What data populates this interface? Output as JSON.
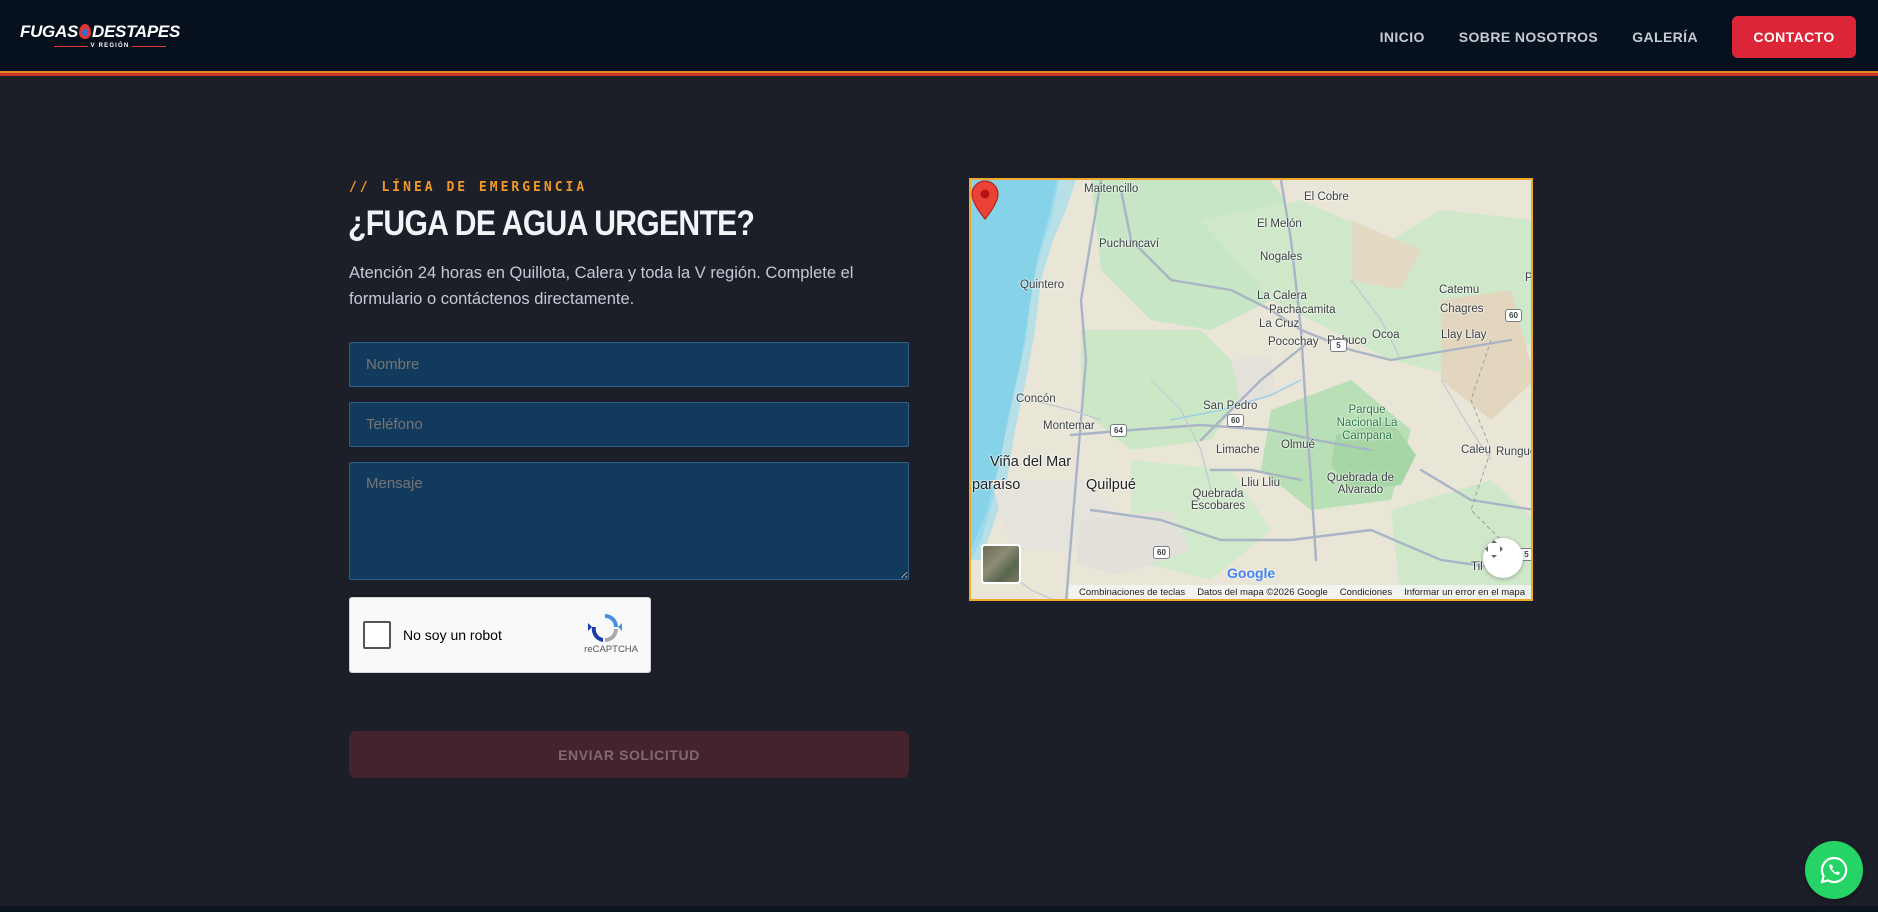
{
  "header": {
    "logo_text_left": "FUGAS",
    "logo_text_right": "DESTAPES",
    "logo_subtitle": "V REGIÓN",
    "nav": [
      {
        "label": "INICIO"
      },
      {
        "label": "SOBRE NOSOTROS"
      },
      {
        "label": "GALERÍA"
      }
    ],
    "cta_label": "CONTACTO"
  },
  "contact": {
    "eyebrow": "// LÍNEA DE EMERGENCIA",
    "title": "¿FUGA DE AGUA URGENTE?",
    "description": "Atención 24 horas en Quillota, Calera y toda la V región. Complete el formulario o contáctenos directamente.",
    "form": {
      "name_placeholder": "Nombre",
      "phone_placeholder": "Teléfono",
      "message_placeholder": "Mensaje",
      "submit_label": "ENVIAR SOLICITUD"
    },
    "recaptcha": {
      "label": "No soy un robot",
      "brand": "reCAPTCHA"
    }
  },
  "map": {
    "places": {
      "maitencillo": "Maitencillo",
      "el_cobre": "El Cobre",
      "el_melon": "El Melón",
      "puchuncavi": "Puchuncaví",
      "nogales": "Nogales",
      "quintero": "Quintero",
      "catemu": "Catemu",
      "la_calera": "La Calera",
      "pachacamita": "Pachacamita",
      "chagres": "Chagres",
      "la_cruz": "La Cruz",
      "pocochay": "Pocochay",
      "rabuco": "Rabuco",
      "ocoa": "Ocoa",
      "llay_llay": "Llay Llay",
      "concon": "Concón",
      "san_pedro": "San Pedro",
      "parque": "Parque Nacional La Campana",
      "montemar": "Montemar",
      "limache": "Limache",
      "olmue": "Olmué",
      "caleu": "Caleu",
      "rungue": "Rungue",
      "vina_del_mar": "Viña del Mar",
      "paraiso": "paraíso",
      "quilpue": "Quilpué",
      "lliu_lliu": "Lliu Lliu",
      "quebrada_alvarado": "Quebrada de Alvarado",
      "quebrada_escobares": "Quebrada Escobares",
      "til": "Til",
      "edge_p": "P"
    },
    "routes": {
      "r5": "5",
      "r60a": "60",
      "r60b": "60",
      "r60c": "60",
      "r64": "64",
      "r5b": "5"
    },
    "google_logo": "Google",
    "attribution": {
      "shortcuts": "Combinaciones de teclas",
      "data": "Datos del mapa ©2026 Google",
      "terms": "Condiciones",
      "report": "Informar un error en el mapa"
    },
    "pin_color": "#ea4335"
  },
  "colors": {
    "accent_orange": "#f09a2a",
    "cta_red": "#dc2638",
    "whatsapp_green": "#25d366"
  }
}
